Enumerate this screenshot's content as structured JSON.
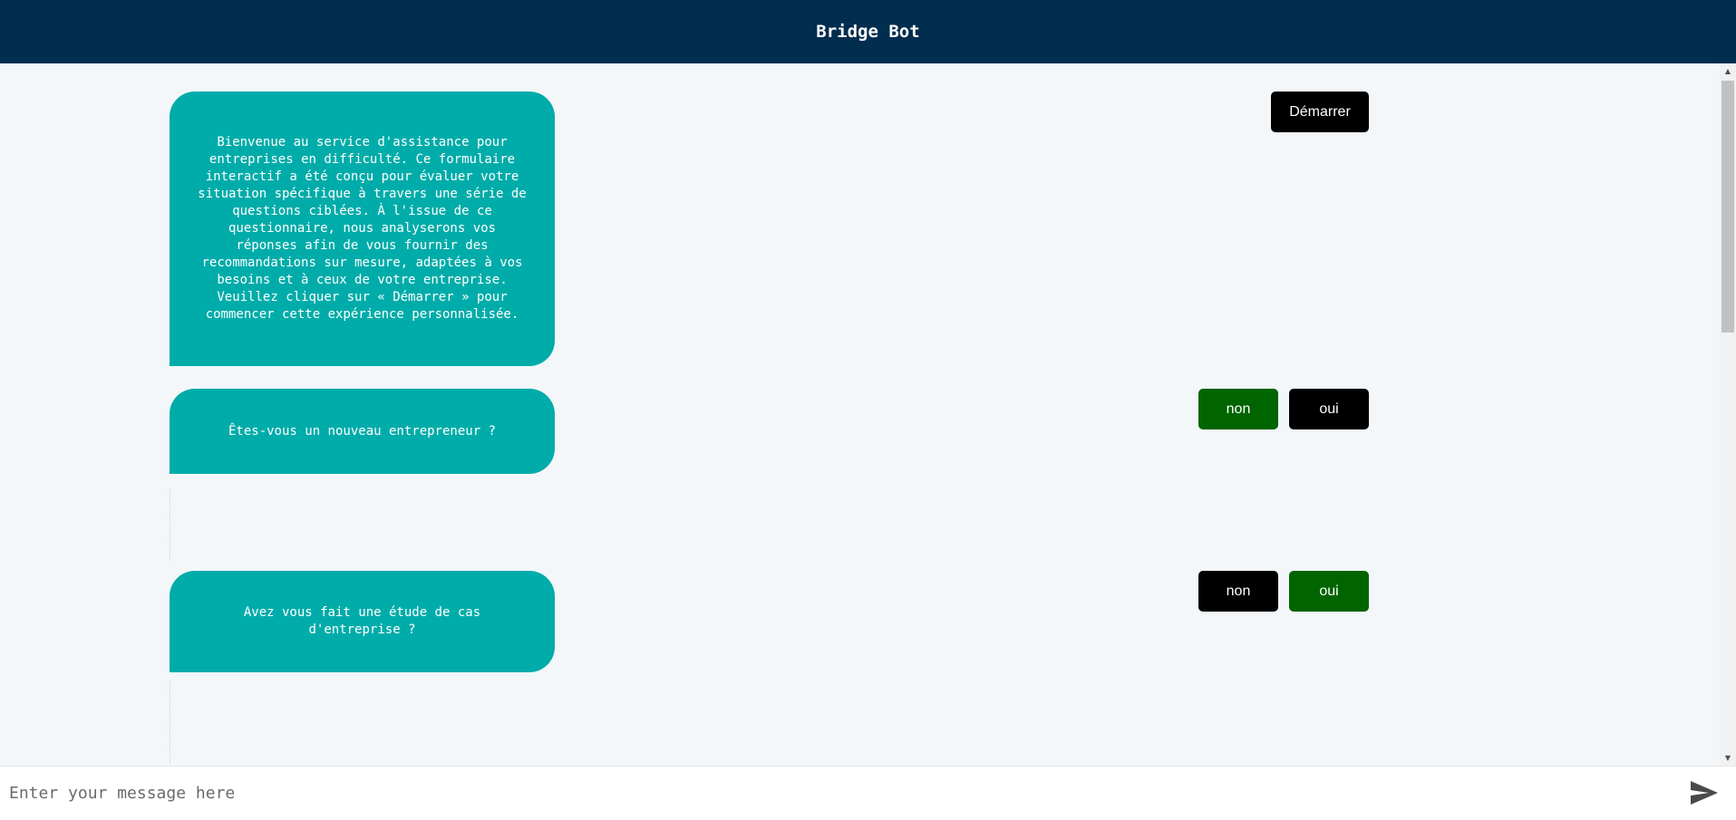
{
  "header": {
    "title": "Bridge Bot"
  },
  "messages": [
    {
      "text": "Bienvenue au service d'assistance pour entreprises en difficulté. Ce formulaire interactif a été conçu pour évaluer votre situation spécifique à travers une série de questions ciblées. À l'issue de ce questionnaire, nous analyserons vos réponses afin de vous fournir des recommandations sur mesure, adaptées à vos besoins et à ceux de votre entreprise. Veuillez cliquer sur « Démarrer » pour commencer cette expérience personnalisée.",
      "buttons": [
        {
          "label": "Démarrer",
          "selected": false
        }
      ]
    },
    {
      "text": "Êtes-vous un nouveau entrepreneur ?",
      "buttons": [
        {
          "label": "non",
          "selected": true
        },
        {
          "label": "oui",
          "selected": false
        }
      ]
    },
    {
      "text": "Avez vous fait une étude de cas d'entreprise ?",
      "buttons": [
        {
          "label": "non",
          "selected": false
        },
        {
          "label": "oui",
          "selected": true
        }
      ]
    }
  ],
  "input": {
    "placeholder": "Enter your message here",
    "value": ""
  },
  "colors": {
    "header_bg": "#012d4f",
    "bubble_bg": "#00aca9",
    "button_default": "#000000",
    "button_selected": "#006400",
    "chat_bg": "#f3f7fa"
  },
  "icons": {
    "send": "send-icon"
  }
}
